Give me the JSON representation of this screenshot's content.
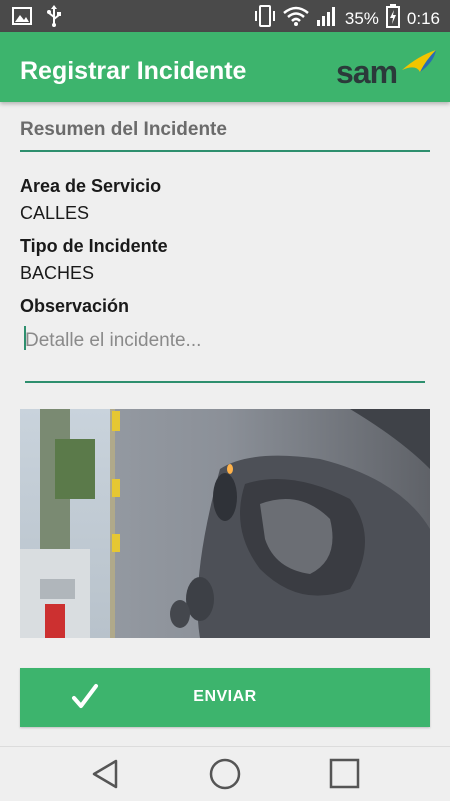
{
  "status_bar": {
    "battery_percent": "35%",
    "time": "0:16",
    "icons": [
      "gallery-icon",
      "usb-icon",
      "vibrate-icon",
      "wifi-icon",
      "signal-icon",
      "battery-charging-icon"
    ]
  },
  "app_bar": {
    "title": "Registrar Incidente",
    "logo_text": "sam"
  },
  "form": {
    "section_title": "Resumen del Incidente",
    "area_label": "Area de Servicio",
    "area_value": "CALLES",
    "tipo_label": "Tipo de Incidente",
    "tipo_value": "BACHES",
    "obs_label": "Observación",
    "obs_value": "",
    "obs_placeholder": "Detalle el incidente..."
  },
  "photo": {
    "description_icon": "pothole-photo"
  },
  "actions": {
    "submit_label": "ENVIAR",
    "submit_icon": "check-icon"
  },
  "nav": {
    "buttons": [
      "back-icon",
      "home-icon",
      "recents-icon"
    ]
  },
  "colors": {
    "primary": "#3db46d",
    "accent": "#2e8f6e",
    "status_bar": "#4a4a4a",
    "background": "#efefef"
  }
}
